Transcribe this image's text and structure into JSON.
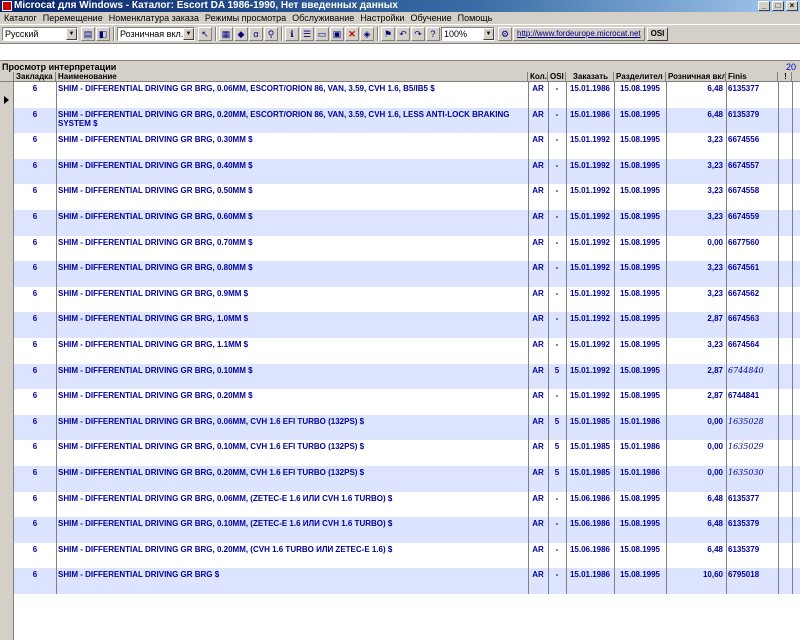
{
  "window": {
    "title": "Microcat для Windows - Каталог: Escort DA 1986-1990, Нет введенных данных"
  },
  "menu": [
    "Каталог",
    "Перемещение",
    "Номенклатура заказа",
    "Режимы просмотра",
    "Обслуживание",
    "Настройки",
    "Обучение",
    "Помощь"
  ],
  "toolbar": {
    "language": "Русский",
    "price_mode": "Розничная вкл.",
    "zoom": "100%",
    "url": "http://www.fordeurope.microcat.net",
    "osi_label": "OSI"
  },
  "panel": {
    "title": "Просмотр интерпретации",
    "count": "20"
  },
  "columns": {
    "bookmark": "Закладка",
    "name": "Наименование",
    "qty": "Кол.",
    "osi": "OSI",
    "order": "Заказать",
    "sep": "Разделител",
    "retail": "Розничная вкл",
    "finis": "Finis",
    "mark": "!"
  },
  "rows": [
    {
      "zak": "6",
      "name": "SHIM - DIFFERENTIAL DRIVING GR BRG, 0.06MM, ESCORT/ORION 86, VAN, 3.59, CVH 1.6, B5/IB5 $",
      "qty": "AR",
      "osi": "-",
      "order": "15.01.1986",
      "sep": "15.08.1995",
      "price": "6,48",
      "finis": "6135377",
      "it": false
    },
    {
      "zak": "6",
      "name": "SHIM - DIFFERENTIAL DRIVING GR BRG, 0.20MM, ESCORT/ORION 86, VAN, 3.59, CVH 1.6, LESS ANTI-LOCK BRAKING SYSTEM $",
      "qty": "AR",
      "osi": "-",
      "order": "15.01.1986",
      "sep": "15.08.1995",
      "price": "6,48",
      "finis": "6135379",
      "it": false
    },
    {
      "zak": "6",
      "name": "SHIM - DIFFERENTIAL DRIVING GR BRG, 0.30MM $",
      "qty": "AR",
      "osi": "-",
      "order": "15.01.1992",
      "sep": "15.08.1995",
      "price": "3,23",
      "finis": "6674556",
      "it": false
    },
    {
      "zak": "6",
      "name": "SHIM - DIFFERENTIAL DRIVING GR BRG, 0.40MM $",
      "qty": "AR",
      "osi": "-",
      "order": "15.01.1992",
      "sep": "15.08.1995",
      "price": "3,23",
      "finis": "6674557",
      "it": false
    },
    {
      "zak": "6",
      "name": "SHIM - DIFFERENTIAL DRIVING GR BRG, 0.50MM $",
      "qty": "AR",
      "osi": "-",
      "order": "15.01.1992",
      "sep": "15.08.1995",
      "price": "3,23",
      "finis": "6674558",
      "it": false
    },
    {
      "zak": "6",
      "name": "SHIM - DIFFERENTIAL DRIVING GR BRG, 0.60MM $",
      "qty": "AR",
      "osi": "-",
      "order": "15.01.1992",
      "sep": "15.08.1995",
      "price": "3,23",
      "finis": "6674559",
      "it": false
    },
    {
      "zak": "6",
      "name": "SHIM - DIFFERENTIAL DRIVING GR BRG, 0.70MM $",
      "qty": "AR",
      "osi": "-",
      "order": "15.01.1992",
      "sep": "15.08.1995",
      "price": "0,00",
      "finis": "6677560",
      "it": false
    },
    {
      "zak": "6",
      "name": "SHIM - DIFFERENTIAL DRIVING GR BRG, 0.80MM $",
      "qty": "AR",
      "osi": "-",
      "order": "15.01.1992",
      "sep": "15.08.1995",
      "price": "3,23",
      "finis": "6674561",
      "it": false
    },
    {
      "zak": "6",
      "name": "SHIM - DIFFERENTIAL DRIVING GR BRG, 0.9MM $",
      "qty": "AR",
      "osi": "-",
      "order": "15.01.1992",
      "sep": "15.08.1995",
      "price": "3,23",
      "finis": "6674562",
      "it": false
    },
    {
      "zak": "6",
      "name": "SHIM - DIFFERENTIAL DRIVING GR BRG, 1.0MM $",
      "qty": "AR",
      "osi": "-",
      "order": "15.01.1992",
      "sep": "15.08.1995",
      "price": "2,87",
      "finis": "6674563",
      "it": false
    },
    {
      "zak": "6",
      "name": "SHIM - DIFFERENTIAL DRIVING GR BRG, 1.1MM $",
      "qty": "AR",
      "osi": "-",
      "order": "15.01.1992",
      "sep": "15.08.1995",
      "price": "3,23",
      "finis": "6674564",
      "it": false
    },
    {
      "zak": "6",
      "name": "SHIM - DIFFERENTIAL DRIVING GR BRG, 0.10MM $",
      "qty": "AR",
      "osi": "5",
      "order": "15.01.1992",
      "sep": "15.08.1995",
      "price": "2,87",
      "finis": "6744840",
      "it": true
    },
    {
      "zak": "6",
      "name": "SHIM - DIFFERENTIAL DRIVING GR BRG, 0.20MM $",
      "qty": "AR",
      "osi": "-",
      "order": "15.01.1992",
      "sep": "15.08.1995",
      "price": "2,87",
      "finis": "6744841",
      "it": false
    },
    {
      "zak": "6",
      "name": "SHIM - DIFFERENTIAL DRIVING GR BRG, 0.06MM, CVH 1.6 EFI TURBO (132PS) $",
      "qty": "AR",
      "osi": "5",
      "order": "15.01.1985",
      "sep": "15.01.1986",
      "price": "0,00",
      "finis": "1635028",
      "it": true
    },
    {
      "zak": "6",
      "name": "SHIM - DIFFERENTIAL DRIVING GR BRG, 0.10MM, CVH 1.6 EFI TURBO (132PS) $",
      "qty": "AR",
      "osi": "5",
      "order": "15.01.1985",
      "sep": "15.01.1986",
      "price": "0,00",
      "finis": "1635029",
      "it": true
    },
    {
      "zak": "6",
      "name": "SHIM - DIFFERENTIAL DRIVING GR BRG, 0.20MM, CVH 1.6 EFI TURBO (132PS) $",
      "qty": "AR",
      "osi": "5",
      "order": "15.01.1985",
      "sep": "15.01.1986",
      "price": "0,00",
      "finis": "1635030",
      "it": true
    },
    {
      "zak": "6",
      "name": "SHIM - DIFFERENTIAL DRIVING GR BRG, 0.06MM, (ZETEC-E 1.6 ИЛИ CVH 1.6 TURBO) $",
      "qty": "AR",
      "osi": "-",
      "order": "15.06.1986",
      "sep": "15.08.1995",
      "price": "6,48",
      "finis": "6135377",
      "it": false
    },
    {
      "zak": "6",
      "name": "SHIM - DIFFERENTIAL DRIVING GR BRG, 0.10MM, (ZETEC-E 1.6 ИЛИ CVH 1.6 TURBO) $",
      "qty": "AR",
      "osi": "-",
      "order": "15.06.1986",
      "sep": "15.08.1995",
      "price": "6,48",
      "finis": "6135379",
      "it": false
    },
    {
      "zak": "6",
      "name": "SHIM - DIFFERENTIAL DRIVING GR BRG, 0.20MM, (CVH 1.6 TURBO ИЛИ ZETEC-E 1.6) $",
      "qty": "AR",
      "osi": "-",
      "order": "15.06.1986",
      "sep": "15.08.1995",
      "price": "6,48",
      "finis": "6135379",
      "it": false
    },
    {
      "zak": "6",
      "name": "SHIM - DIFFERENTIAL DRIVING GR BRG $",
      "qty": "AR",
      "osi": "-",
      "order": "15.01.1986",
      "sep": "15.08.1995",
      "price": "10,60",
      "finis": "6795018",
      "it": false
    }
  ]
}
